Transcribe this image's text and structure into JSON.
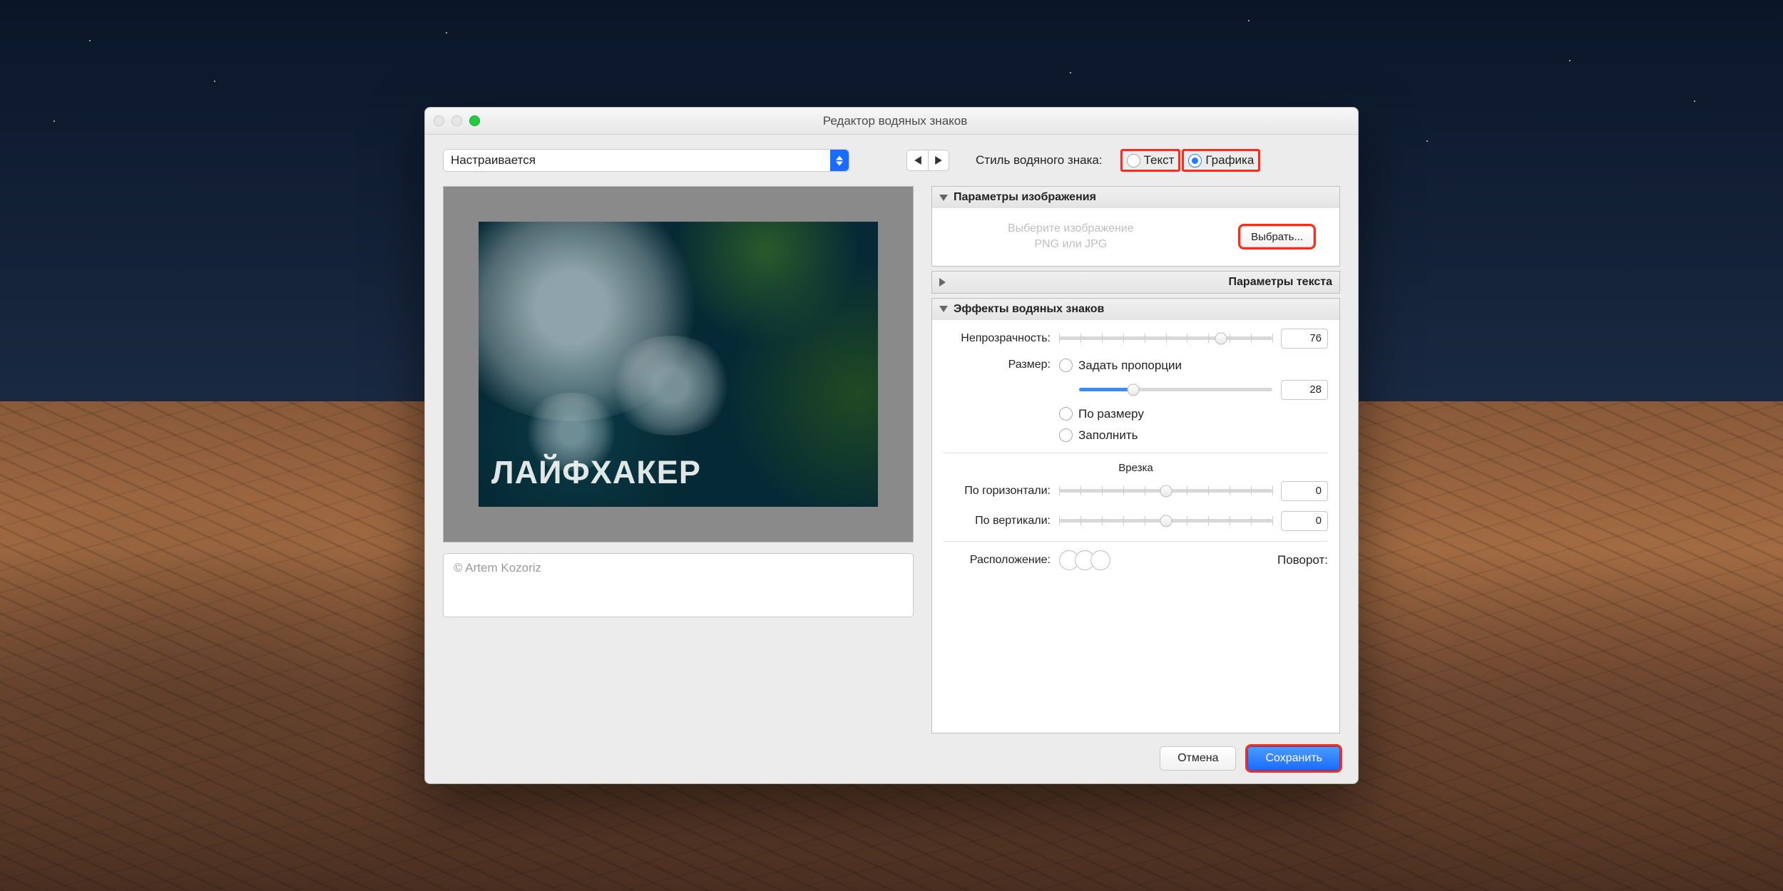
{
  "window": {
    "title": "Редактор водяных знаков"
  },
  "toprow": {
    "preset_label": "Настраивается",
    "style_label": "Стиль водяного знака:",
    "style_text": "Текст",
    "style_graphic": "Графика"
  },
  "preview": {
    "watermark_text": "ЛАЙФХАКЕР",
    "copyright_placeholder": "© Artem Kozoriz"
  },
  "panels": {
    "image_params": {
      "title": "Параметры изображения",
      "hint_line1": "Выберите изображение",
      "hint_line2": "PNG или JPG",
      "choose_btn": "Выбрать..."
    },
    "text_params": {
      "title": "Параметры текста"
    },
    "effects": {
      "title": "Эффекты водяных знаков",
      "opacity_label": "Непрозрачность:",
      "opacity_value": "76",
      "size_label": "Размер:",
      "size_proportional": "Задать пропорции",
      "size_value": "28",
      "size_fit": "По размеру",
      "size_fill": "Заполнить",
      "inset_label": "Врезка",
      "horizontal_label": "По горизонтали:",
      "horizontal_value": "0",
      "vertical_label": "По вертикали:",
      "vertical_value": "0",
      "placement_label": "Расположение:",
      "rotation_label": "Поворот:"
    }
  },
  "footer": {
    "cancel": "Отмена",
    "save": "Сохранить"
  }
}
